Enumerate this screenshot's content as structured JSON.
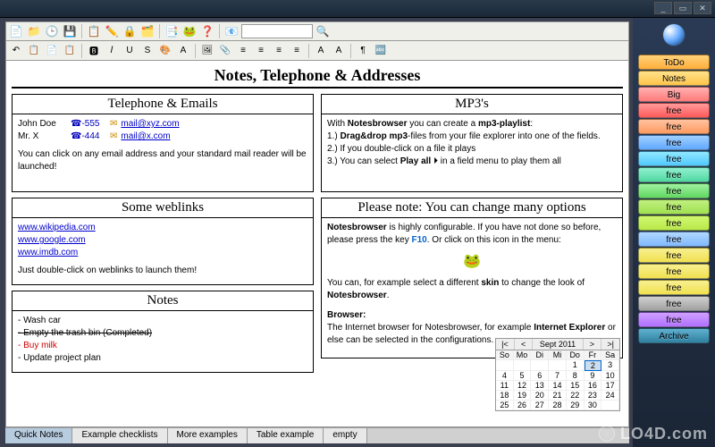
{
  "page_title": "Notes, Telephone & Addresses",
  "toolbar1_icons": [
    "📄",
    "📁",
    "🕒",
    "💾",
    "📋",
    "✏️",
    "🔒",
    "🗂️",
    "📑",
    "🐸",
    "❓",
    "📧",
    "🔍"
  ],
  "toolbar2_icons": [
    "↶",
    "📋",
    "📄",
    "📋",
    "│",
    "🅱",
    "𝐼",
    "U",
    "S",
    "🎨",
    "A",
    "│",
    "🖼",
    "📎",
    "≡",
    "≡",
    "≡",
    "≡",
    "│",
    "A",
    "A",
    "│",
    "¶",
    "🔤"
  ],
  "sections": {
    "tel": {
      "title": "Telephone & Emails",
      "contacts": [
        {
          "name": "John Doe",
          "phone": "☎-555",
          "email": "mail@xyz.com"
        },
        {
          "name": "Mr. X",
          "phone": "☎-444",
          "email": "mail@x.com"
        }
      ],
      "note": "You can click on any email address and your standard mail reader will be launched!"
    },
    "mp3": {
      "title": "MP3's",
      "intro_prefix": "With ",
      "intro_bold": "Notesbrowser",
      "intro_suffix": " you can create a ",
      "intro_bold2": "mp3-playlist",
      "items": [
        {
          "n": "1.)",
          "pre": "",
          "b": "Drag&drop mp3",
          "post": "-files from your file explorer into one of the fields."
        },
        {
          "n": "2.)",
          "pre": "If you double-click on a file it plays",
          "b": "",
          "post": ""
        },
        {
          "n": "3.)",
          "pre": "You can select ",
          "b": "Play all",
          "post": " ⏵ in a field menu to play them all"
        }
      ]
    },
    "web": {
      "title": "Some weblinks",
      "links": [
        "www.wikipedia.com",
        "www.google.com",
        "www.imdb.com"
      ],
      "note": "Just double-click on weblinks to launch them!"
    },
    "opts": {
      "title": "Please note: You can change many options",
      "line1_b": "Notesbrowser",
      "line1": " is highly configurable. If you have not done so before, please press the key ",
      "line1_key": "F10",
      "line1_end": ". Or click on this icon in the menu:",
      "line2_pre": "You can, for example select a different ",
      "line2_b": "skin",
      "line2_post": " to change the look of ",
      "line2_b2": "Notesbrowser",
      "browser_h": "Browser:",
      "browser_t1": "The Internet browser for Notesbrowser, for example ",
      "browser_b": "Internet Explorer",
      "browser_t2": " or else can be selected in the configurations."
    },
    "notes": {
      "title": "Notes",
      "items": [
        {
          "text": "- Wash car",
          "strike": false,
          "red": false
        },
        {
          "text": "- Empty the trash bin (Completed)",
          "strike": true,
          "red": false
        },
        {
          "text": "- Buy milk",
          "strike": false,
          "red": true
        },
        {
          "text": "- Update project plan",
          "strike": false,
          "red": false
        }
      ]
    }
  },
  "tabs": [
    "Quick Notes",
    "Example checklists",
    "More examples",
    "Table example",
    "empty"
  ],
  "active_tab": 0,
  "sidebar": [
    {
      "label": "ToDo",
      "color": "linear-gradient(#ffd27a,#ffae3a)"
    },
    {
      "label": "Notes",
      "color": "linear-gradient(#ffe28a,#ffc44a)"
    },
    {
      "label": "Big",
      "color": "linear-gradient(#ffb0b0,#ff7a7a)"
    },
    {
      "label": "free",
      "color": "linear-gradient(#ff9a9a,#ff5a5a)"
    },
    {
      "label": "free",
      "color": "linear-gradient(#ffc2a0,#ff9a60)"
    },
    {
      "label": "free",
      "color": "linear-gradient(#a0d0ff,#60a8ff)"
    },
    {
      "label": "free",
      "color": "linear-gradient(#90e8ff,#50c8ff)"
    },
    {
      "label": "free",
      "color": "linear-gradient(#90f0d0,#50d8a0)"
    },
    {
      "label": "free",
      "color": "linear-gradient(#a0f0a0,#60d860)"
    },
    {
      "label": "free",
      "color": "linear-gradient(#c0f080,#a0e050)"
    },
    {
      "label": "free",
      "color": "linear-gradient(#d0f870,#b8e848)"
    },
    {
      "label": "free",
      "color": "linear-gradient(#b0d8ff,#80b8ff)"
    },
    {
      "label": "free",
      "color": "linear-gradient(#f8f090,#f0e050)"
    },
    {
      "label": "free",
      "color": "linear-gradient(#f8f090,#f0e050)"
    },
    {
      "label": "free",
      "color": "linear-gradient(#f8f090,#f0e050)"
    },
    {
      "label": "free",
      "color": "linear-gradient(#d0d0d0,#a0a0a0)"
    },
    {
      "label": "free",
      "color": "linear-gradient(#d0a0ff,#b070ff)"
    },
    {
      "label": "Archive",
      "color": "linear-gradient(#60b0d0,#3080a0)"
    }
  ],
  "calendar": {
    "title": "Sept 2011",
    "nav": {
      "first": "|<",
      "prev": "<",
      "next": ">",
      "last": ">|"
    },
    "days": [
      "So",
      "Mo",
      "Di",
      "Mi",
      "Do",
      "Fr",
      "Sa"
    ],
    "grid": [
      "",
      "",
      "",
      "",
      "1",
      "2",
      "3",
      "4",
      "5",
      "6",
      "7",
      "8",
      "9",
      "10",
      "11",
      "12",
      "13",
      "14",
      "15",
      "16",
      "17",
      "18",
      "19",
      "20",
      "21",
      "22",
      "23",
      "24",
      "25",
      "26",
      "27",
      "28",
      "29",
      "30",
      ""
    ],
    "today_index": 5
  },
  "watermark": "LO4D.com"
}
